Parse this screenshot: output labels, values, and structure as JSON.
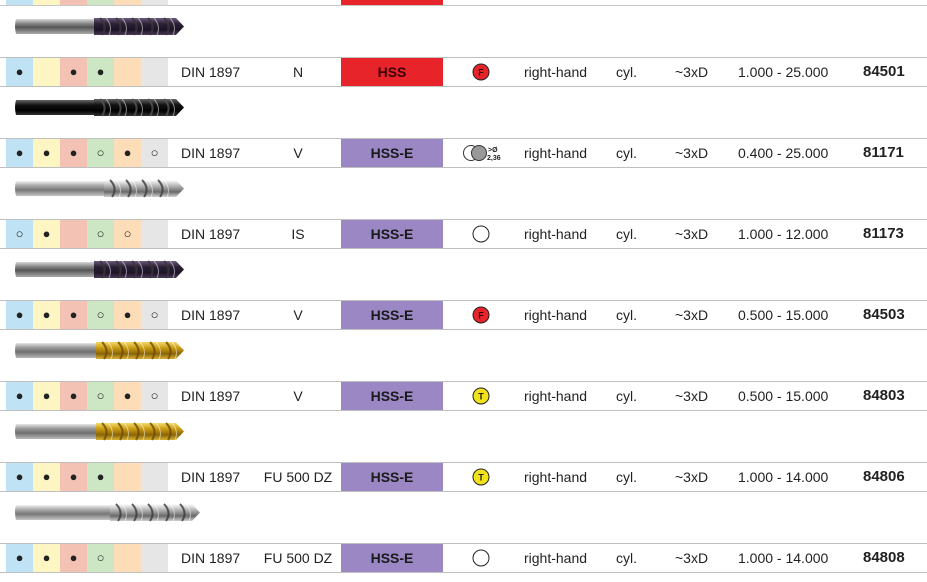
{
  "colors": {
    "hss_red": "#e8242b",
    "hsse_purple": "#9b87c3",
    "material_columns": [
      "#bfe3f5",
      "#fdf6c3",
      "#f4c2b4",
      "#cde7c4",
      "#fddcb8",
      "#e6e6e6"
    ],
    "coating_red": "#e8242b",
    "coating_yellow": "#f2e21a"
  },
  "rows": [
    {
      "tool_icon": "drill-dark-violet-icon",
      "materials": [
        "●",
        "",
        "●",
        "●",
        "",
        ""
      ],
      "standard": "DIN 1897",
      "type": "N",
      "material": "HSS",
      "material_color": "red",
      "coating_icon": "coating-f-red-icon",
      "coating_text": "F",
      "direction": "right-hand",
      "shank": "cyl.",
      "length": "~3xD",
      "range": "1.000 - 25.000",
      "article": "84501"
    },
    {
      "tool_icon": "drill-black-icon",
      "materials": [
        "●",
        "●",
        "●",
        "○",
        "●",
        "○"
      ],
      "standard": "DIN 1897",
      "type": "V",
      "material": "HSS-E",
      "material_color": "purple",
      "coating_icon": "coating-steam-icon",
      "coating_text": ">Ø 2,36",
      "direction": "right-hand",
      "shank": "cyl.",
      "length": "~3xD",
      "range": "0.400 - 25.000",
      "article": "81171"
    },
    {
      "tool_icon": "drill-bright-icon",
      "materials": [
        "○",
        "●",
        "",
        "○",
        "○",
        ""
      ],
      "standard": "DIN 1897",
      "type": "IS",
      "material": "HSS-E",
      "material_color": "purple",
      "coating_icon": "coating-none-icon",
      "coating_text": "",
      "direction": "right-hand",
      "shank": "cyl.",
      "length": "~3xD",
      "range": "1.000 - 12.000",
      "article": "81173"
    },
    {
      "tool_icon": "drill-dark-violet-icon",
      "materials": [
        "●",
        "●",
        "●",
        "○",
        "●",
        "○"
      ],
      "standard": "DIN 1897",
      "type": "V",
      "material": "HSS-E",
      "material_color": "purple",
      "coating_icon": "coating-f-red-icon",
      "coating_text": "F",
      "direction": "right-hand",
      "shank": "cyl.",
      "length": "~3xD",
      "range": "0.500 - 15.000",
      "article": "84503"
    },
    {
      "tool_icon": "drill-gold-icon",
      "materials": [
        "●",
        "●",
        "●",
        "○",
        "●",
        "○"
      ],
      "standard": "DIN 1897",
      "type": "V",
      "material": "HSS-E",
      "material_color": "purple",
      "coating_icon": "coating-t-yellow-icon",
      "coating_text": "T",
      "direction": "right-hand",
      "shank": "cyl.",
      "length": "~3xD",
      "range": "0.500 - 15.000",
      "article": "84803"
    },
    {
      "tool_icon": "drill-gold-icon",
      "materials": [
        "●",
        "●",
        "●",
        "●",
        "",
        ""
      ],
      "standard": "DIN 1897",
      "type": "FU 500 DZ",
      "material": "HSS-E",
      "material_color": "purple",
      "coating_icon": "coating-t-yellow-icon",
      "coating_text": "T",
      "direction": "right-hand",
      "shank": "cyl.",
      "length": "~3xD",
      "range": "1.000 - 14.000",
      "article": "84806"
    },
    {
      "tool_icon": "drill-bright-long-icon",
      "materials": [
        "●",
        "●",
        "●",
        "○",
        "",
        ""
      ],
      "standard": "DIN 1897",
      "type": "FU 500 DZ",
      "material": "HSS-E",
      "material_color": "purple",
      "coating_icon": "coating-none-icon",
      "coating_text": "",
      "direction": "right-hand",
      "shank": "cyl.",
      "length": "~3xD",
      "range": "1.000 - 14.000",
      "article": "84808"
    }
  ]
}
